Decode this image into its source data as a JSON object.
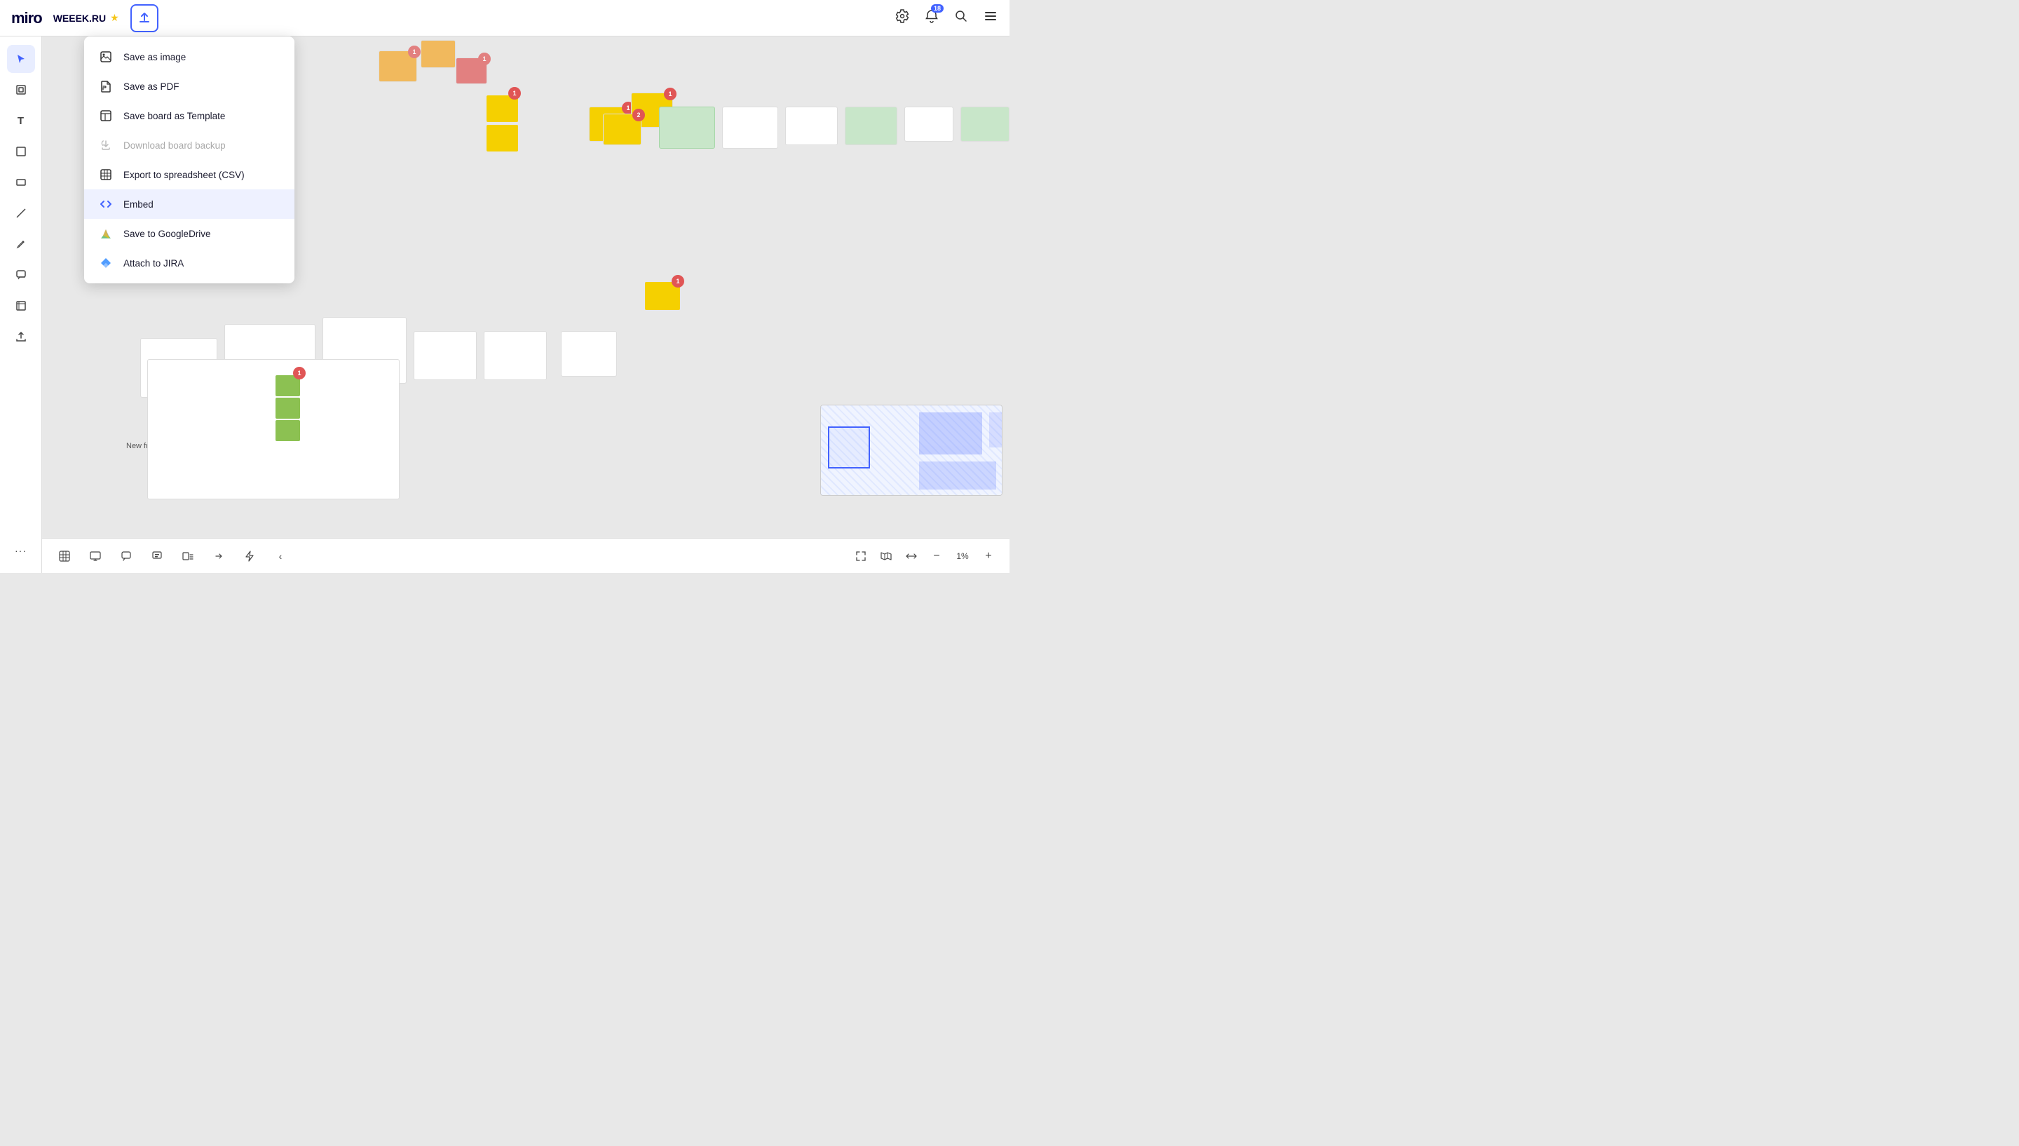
{
  "header": {
    "logo": "miro",
    "board_name": "WEEEK.RU",
    "export_button_label": "↑",
    "right_icons": {
      "settings_icon": "⚙",
      "notifications_icon": "🔔",
      "notifications_badge": "18",
      "search_icon": "🔍",
      "menu_icon": "☰"
    }
  },
  "toolbar": {
    "tools": [
      {
        "name": "cursor",
        "icon": "↖",
        "active": true
      },
      {
        "name": "frames",
        "icon": "⊞"
      },
      {
        "name": "text",
        "icon": "T"
      },
      {
        "name": "sticky-note",
        "icon": "⬛"
      },
      {
        "name": "rectangle",
        "icon": "▭"
      },
      {
        "name": "line",
        "icon": "/"
      },
      {
        "name": "pen",
        "icon": "✏"
      },
      {
        "name": "comment",
        "icon": "💬"
      },
      {
        "name": "crop",
        "icon": "⊡"
      },
      {
        "name": "upload",
        "icon": "⬆"
      },
      {
        "name": "more",
        "icon": "···"
      }
    ]
  },
  "bottom_toolbar": {
    "tools": [
      {
        "name": "grid",
        "icon": "⊞"
      },
      {
        "name": "present",
        "icon": "▷"
      },
      {
        "name": "comment",
        "icon": "💬"
      },
      {
        "name": "chat",
        "icon": "⬜"
      },
      {
        "name": "frames-list",
        "icon": "⊟"
      },
      {
        "name": "share",
        "icon": "↗"
      },
      {
        "name": "lightning",
        "icon": "⚡"
      },
      {
        "name": "collapse",
        "icon": "‹"
      }
    ],
    "zoom": {
      "fit_icon": "⤢",
      "map_icon": "🗺",
      "fit_width_icon": "↔",
      "zoom_out": "−",
      "zoom_in": "+",
      "zoom_level": "1%"
    }
  },
  "dropdown_menu": {
    "items": [
      {
        "id": "save-image",
        "label": "Save as image",
        "icon_type": "image",
        "disabled": false,
        "active": false
      },
      {
        "id": "save-pdf",
        "label": "Save as PDF",
        "icon_type": "pdf",
        "disabled": false,
        "active": false
      },
      {
        "id": "save-template",
        "label": "Save board as Template",
        "icon_type": "template",
        "disabled": false,
        "active": false
      },
      {
        "id": "download-backup",
        "label": "Download board backup",
        "icon_type": "backup",
        "disabled": true,
        "active": false
      },
      {
        "id": "export-csv",
        "label": "Export to spreadsheet (CSV)",
        "icon_type": "csv",
        "disabled": false,
        "active": false
      },
      {
        "id": "embed",
        "label": "Embed",
        "icon_type": "embed",
        "disabled": false,
        "active": true
      },
      {
        "id": "google-drive",
        "label": "Save to GoogleDrive",
        "icon_type": "drive",
        "disabled": false,
        "active": false
      },
      {
        "id": "jira",
        "label": "Attach to JIRA",
        "icon_type": "jira",
        "disabled": false,
        "active": false
      }
    ]
  },
  "minimap": {
    "zoom_level": "1%"
  },
  "canvas": {
    "new_frame_label": "New frame"
  }
}
